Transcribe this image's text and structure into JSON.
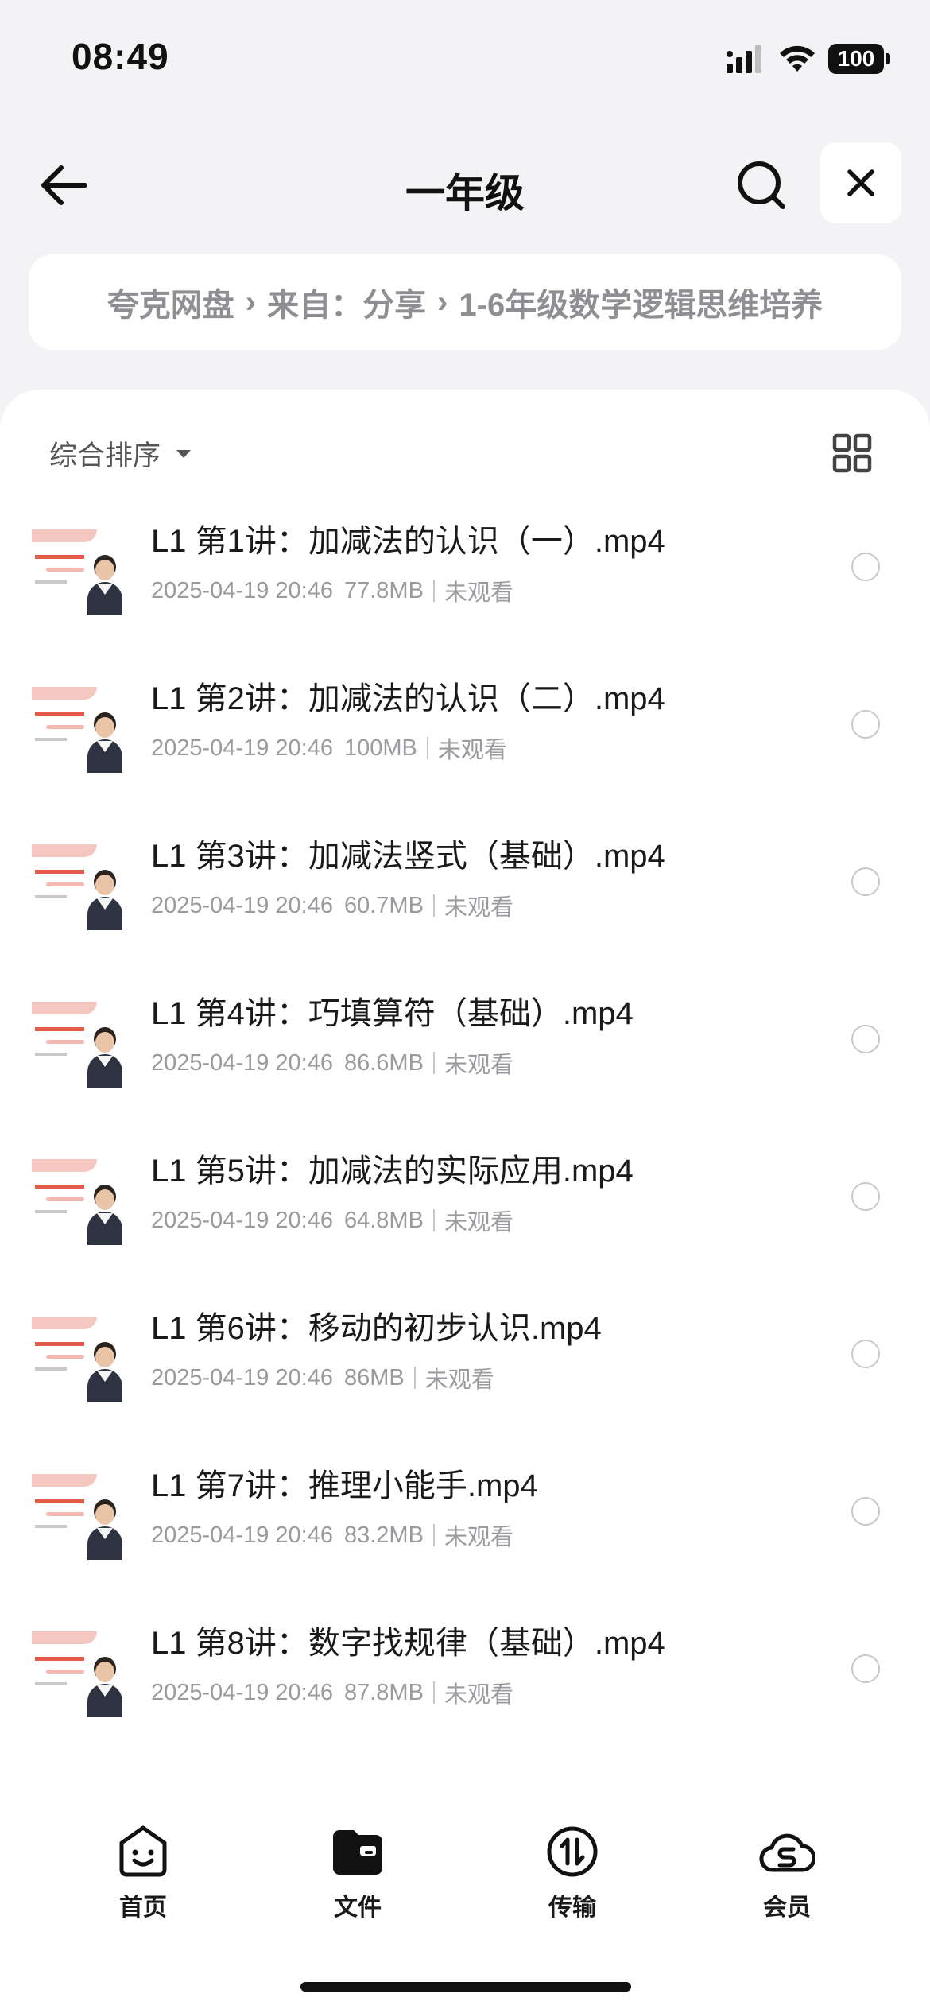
{
  "status_bar": {
    "time": "08:49",
    "battery": "100"
  },
  "header": {
    "title": "一年级"
  },
  "breadcrumb": [
    {
      "label": "夸克网盘"
    },
    {
      "label": "来自：分享"
    },
    {
      "label": "1-6年级数学逻辑思维培养"
    }
  ],
  "toolbar": {
    "sort_label": "综合排序"
  },
  "files": [
    {
      "name": "L1 第1讲：加减法的认识（一）.mp4",
      "date": "2025-04-19 20:46",
      "size": "77.8MB",
      "status": "未观看"
    },
    {
      "name": "L1 第2讲：加减法的认识（二）.mp4",
      "date": "2025-04-19 20:46",
      "size": "100MB",
      "status": "未观看"
    },
    {
      "name": "L1 第3讲：加减法竖式（基础）.mp4",
      "date": "2025-04-19 20:46",
      "size": "60.7MB",
      "status": "未观看"
    },
    {
      "name": "L1 第4讲：巧填算符（基础）.mp4",
      "date": "2025-04-19 20:46",
      "size": "86.6MB",
      "status": "未观看"
    },
    {
      "name": "L1 第5讲：加减法的实际应用.mp4",
      "date": "2025-04-19 20:46",
      "size": "64.8MB",
      "status": "未观看"
    },
    {
      "name": "L1 第6讲：移动的初步认识.mp4",
      "date": "2025-04-19 20:46",
      "size": "86MB",
      "status": "未观看"
    },
    {
      "name": "L1 第7讲：推理小能手.mp4",
      "date": "2025-04-19 20:46",
      "size": "83.2MB",
      "status": "未观看"
    },
    {
      "name": "L1 第8讲：数字找规律（基础）.mp4",
      "date": "2025-04-19 20:46",
      "size": "87.8MB",
      "status": "未观看"
    }
  ],
  "tabs": [
    {
      "label": "首页",
      "icon": "smiley-home-icon"
    },
    {
      "label": "文件",
      "icon": "folder-icon"
    },
    {
      "label": "传输",
      "icon": "transfer-icon"
    },
    {
      "label": "会员",
      "icon": "cloud-member-icon"
    }
  ]
}
